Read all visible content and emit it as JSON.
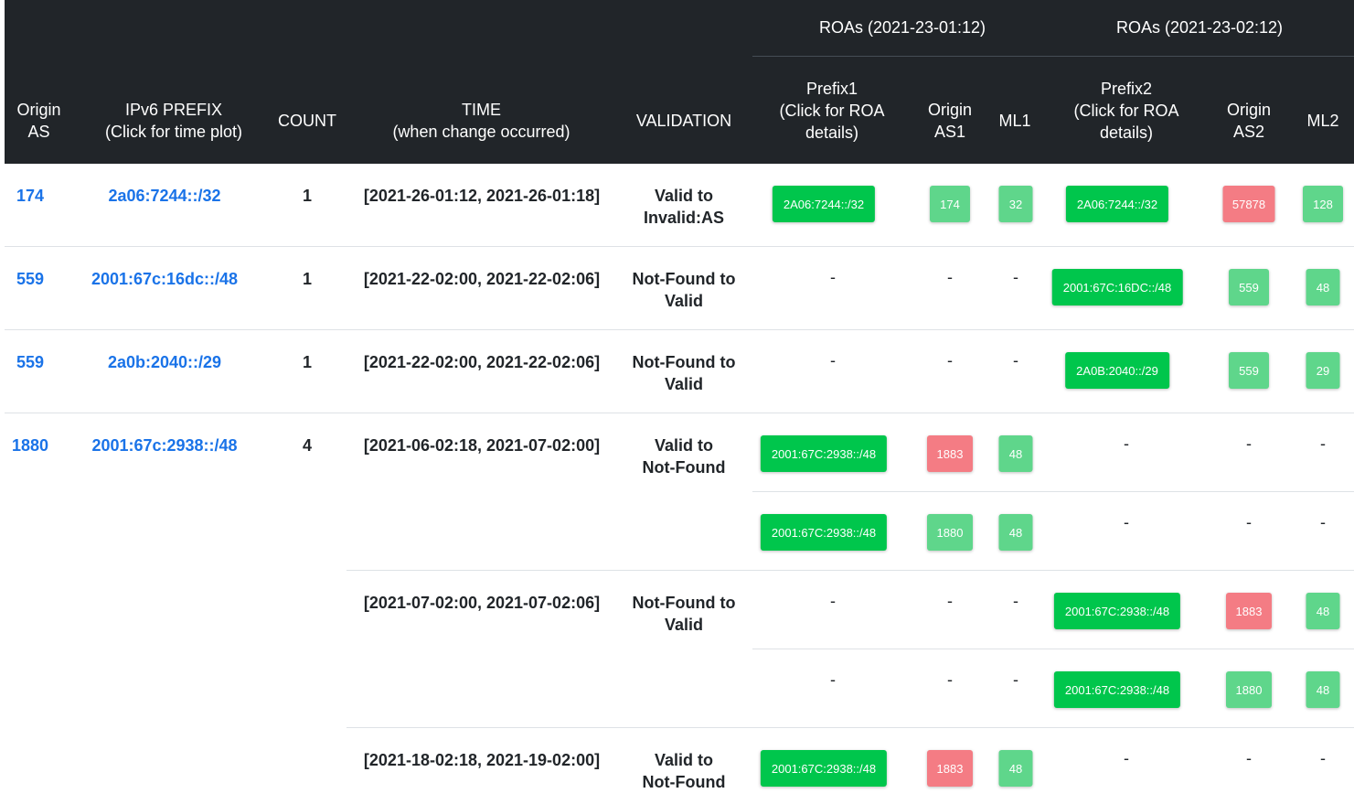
{
  "header": {
    "group1": "ROAs (2021-23-01:12)",
    "group2": "ROAs (2021-23-02:12)",
    "col_origin_as": "Origin\nAS",
    "col_prefix": "IPv6 PREFIX\n(Click for time plot)",
    "col_count": "COUNT",
    "col_time": "TIME\n(when change occurred)",
    "col_validation": "VALIDATION",
    "col_prefix1": "Prefix1\n(Click for ROA\ndetails)",
    "col_origin_as1": "Origin\nAS1",
    "col_ml1": "ML1",
    "col_prefix2": "Prefix2\n(Click for ROA\ndetails)",
    "col_origin_as2": "Origin\nAS2",
    "col_ml2": "ML2"
  },
  "rows": [
    {
      "origin_as": "174",
      "prefix": "2a06:7244::/32",
      "count": "1",
      "time": "[2021-26-01:12, 2021-26-01:18]",
      "validation": "Valid to\nInvalid:AS",
      "p1": "2A06:7244::/32",
      "as1": "174",
      "ml1": "32",
      "p2": "2A06:7244::/32",
      "as2": "57878",
      "ml2": "128"
    },
    {
      "origin_as": "559",
      "prefix": "2001:67c:16dc::/48",
      "count": "1",
      "time": "[2021-22-02:00, 2021-22-02:06]",
      "validation": "Not-Found to\nValid",
      "p1": "-",
      "as1": "-",
      "ml1": "-",
      "p2": "2001:67C:16DC::/48",
      "as2": "559",
      "ml2": "48"
    },
    {
      "origin_as": "559",
      "prefix": "2a0b:2040::/29",
      "count": "1",
      "time": "[2021-22-02:00, 2021-22-02:06]",
      "validation": "Not-Found to\nValid",
      "p1": "-",
      "as1": "-",
      "ml1": "-",
      "p2": "2A0B:2040::/29",
      "as2": "559",
      "ml2": "29"
    },
    {
      "origin_as": "1880",
      "prefix": "2001:67c:2938::/48",
      "count": "4",
      "time": "[2021-06-02:18, 2021-07-02:00]",
      "validation": "Valid to\nNot-Found",
      "p1": "2001:67C:2938::/48",
      "as1": "1883",
      "ml1": "48",
      "p2": "-",
      "as2": "-",
      "ml2": "-",
      "sub_p1": "2001:67C:2938::/48",
      "sub_as1": "1880",
      "sub_ml1": "48",
      "sub_p2": "-",
      "sub_as2": "-",
      "sub_ml2": "-"
    },
    {
      "time": "[2021-07-02:00, 2021-07-02:06]",
      "validation": "Not-Found to\nValid",
      "p1": "-",
      "as1": "-",
      "ml1": "-",
      "p2": "2001:67C:2938::/48",
      "as2": "1883",
      "ml2": "48",
      "sub_p1": "-",
      "sub_as1": "-",
      "sub_ml1": "-",
      "sub_p2": "2001:67C:2938::/48",
      "sub_as2": "1880",
      "sub_ml2": "48"
    },
    {
      "time": "[2021-18-02:18, 2021-19-02:00]",
      "validation": "Valid to\nNot-Found",
      "p1": "2001:67C:2938::/48",
      "as1": "1883",
      "ml1": "48",
      "p2": "-",
      "as2": "-",
      "ml2": "-"
    }
  ],
  "colors": {
    "header_bg": "#212529",
    "link": "#1a73e8",
    "badge_prefix": "#00c64c",
    "badge_valid": "#5fd68b",
    "badge_invalid": "#f47c84"
  }
}
